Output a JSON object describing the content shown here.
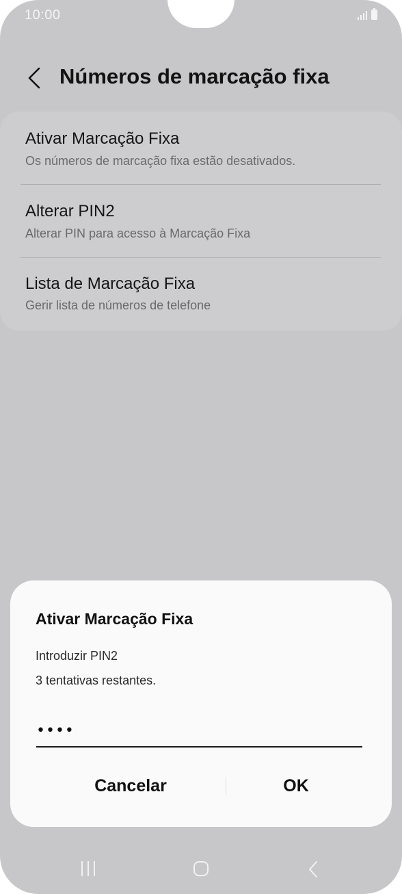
{
  "status_bar": {
    "time": "10:00"
  },
  "header": {
    "title": "Números de marcação fixa"
  },
  "settings": {
    "items": [
      {
        "title": "Ativar Marcação Fixa",
        "subtitle": "Os números de marcação fixa estão desativados."
      },
      {
        "title": "Alterar PIN2",
        "subtitle": "Alterar PIN para acesso à Marcação Fixa"
      },
      {
        "title": "Lista de Marcação Fixa",
        "subtitle": "Gerir lista de números de telefone"
      }
    ]
  },
  "dialog": {
    "title": "Ativar Marcação Fixa",
    "message_line1": "Introduzir PIN2",
    "message_line2": "3 tentativas restantes.",
    "pin_value": "••••",
    "cancel_label": "Cancelar",
    "ok_label": "OK"
  },
  "icons": {
    "back": "chevron-left-icon",
    "signal": "signal-icon",
    "battery": "battery-icon",
    "nav_recents": "recents-icon",
    "nav_home": "home-icon",
    "nav_back": "nav-back-icon"
  },
  "colors": {
    "background": "#c7c7c9",
    "card": "#cdcdcf",
    "dialog": "#fafafa",
    "text_primary": "#121212",
    "text_secondary": "#6a6a6c"
  }
}
